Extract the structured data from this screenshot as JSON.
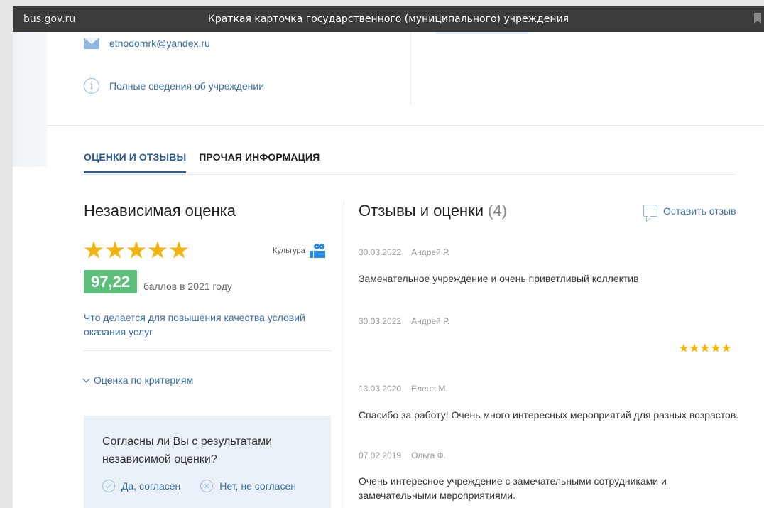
{
  "titlebar": {
    "domain": "bus.gov.ru",
    "title": "Краткая карточка государственного (муниципального) учреждения"
  },
  "contacts": {
    "email": "etnodomrk@yandex.ru",
    "full_info_label": "Полные сведения об учреждении"
  },
  "tabs": [
    {
      "label": "ОЦЕНКИ И ОТЗЫВЫ",
      "active": true
    },
    {
      "label": "ПРОЧАЯ ИНФОРМАЦИЯ",
      "active": false
    }
  ],
  "independent": {
    "heading": "Независимая оценка",
    "stars": 5,
    "category": "Культура",
    "score": "97,22",
    "score_note": "баллов в 2021 году",
    "quality_link": "Что делается для повышения качества условий оказания услуг",
    "criteria_label": "Оценка по критериям",
    "agree_question": "Согласны ли Вы с результатами независимой оценки?",
    "agree_yes": "Да, согласен",
    "agree_no": "Нет, не согласен"
  },
  "reviews": {
    "heading": "Отзывы и оценки",
    "count": "(4)",
    "leave_review": "Оставить отзыв",
    "items": [
      {
        "date": "30.03.2022",
        "author": "Андрей Р.",
        "text": "Замечательное учреждение и очень приветливый коллектив",
        "stars": 0
      },
      {
        "date": "30.03.2022",
        "author": "Андрей Р.",
        "text": "",
        "stars": 5
      },
      {
        "date": "13.03.2020",
        "author": "Елена М.",
        "text": "Спасибо за работу! Очень много интересных мероприятий для разных возрастов.",
        "stars": 0
      },
      {
        "date": "07.02.2019",
        "author": "Ольга Ф.",
        "text": "Очень интересное учреждение с замечательными сотрудниками и замечательными мероприятиями.",
        "stars": 0
      }
    ]
  },
  "colors": {
    "titlebar_bg": "#3b3b3b",
    "accent_blue": "#2b5d94",
    "link_blue": "#3a6ea5",
    "star_gold": "#f2b30c",
    "score_green": "#5bbf7a",
    "agree_box_bg": "#eaf1f8"
  }
}
